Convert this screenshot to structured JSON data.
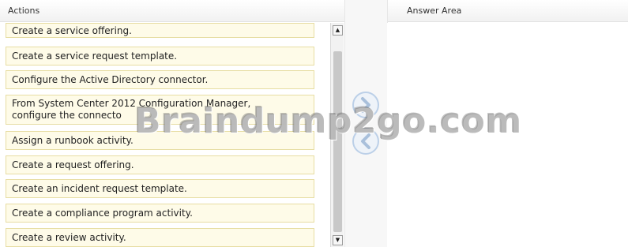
{
  "actions_panel": {
    "header": "Actions",
    "items": [
      "Create a service offering.",
      "Create a service request template.",
      "Configure the Active Directory connector.",
      "From System Center 2012 Configuration Manager,",
      "configure the connecto",
      "Assign a runbook activity.",
      "Create a request offering.",
      "Create an incident request template.",
      "Create a compliance program activity.",
      "Create a review activity."
    ]
  },
  "answer_panel": {
    "header": "Answer Area"
  },
  "scrollbar": {
    "up_arrow": "▲",
    "down_arrow": "▼"
  },
  "watermark": "Braindump2go.com",
  "colors": {
    "item_bg": "#fefbe8",
    "item_border": "#e7dda3",
    "arrow_button": "#bcd0e8"
  },
  "icons": {
    "move_right": "chevron-right-icon",
    "move_left": "chevron-left-icon"
  }
}
